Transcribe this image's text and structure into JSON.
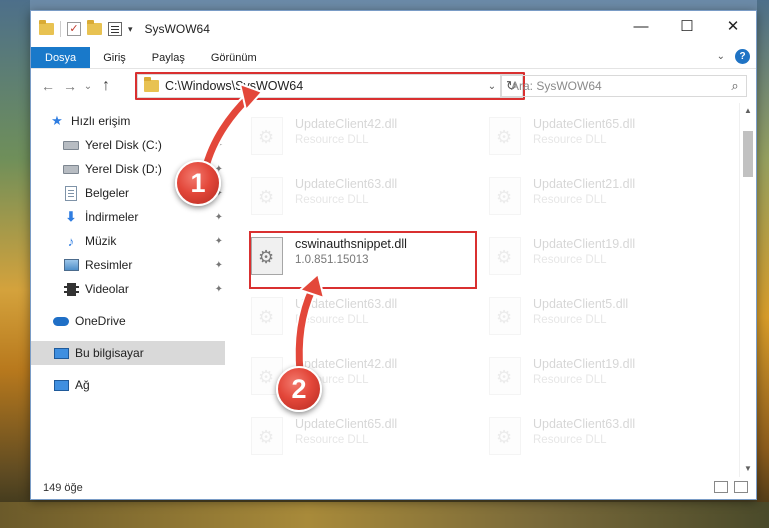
{
  "window": {
    "title": "SysWOW64",
    "controls": {
      "minimize": "—",
      "maximize": "☐",
      "close": "✕"
    }
  },
  "ribbon": {
    "tabs": [
      "Dosya",
      "Giriş",
      "Paylaş",
      "Görünüm"
    ],
    "expand_glyph": "⌄",
    "help_glyph": "?"
  },
  "nav": {
    "back": "←",
    "forward": "→",
    "recent": "⌄",
    "up": "↑",
    "address": "C:\\Windows\\SysWOW64",
    "address_dropdown": "⌄",
    "refresh": "↻",
    "search_placeholder": "Ara: SysWOW64",
    "search_glyph": "⌕"
  },
  "sidebar": {
    "items": [
      {
        "label": "Hızlı erişim",
        "icon": "star-icon",
        "pinned": false
      },
      {
        "label": "Yerel Disk (C:)",
        "icon": "drive-icon",
        "pinned": true
      },
      {
        "label": "Yerel Disk (D:)",
        "icon": "drive-icon",
        "pinned": true
      },
      {
        "label": "Belgeler",
        "icon": "documents-icon",
        "pinned": true
      },
      {
        "label": "İndirmeler",
        "icon": "downloads-icon",
        "pinned": true
      },
      {
        "label": "Müzik",
        "icon": "music-icon",
        "pinned": true
      },
      {
        "label": "Resimler",
        "icon": "pictures-icon",
        "pinned": true
      },
      {
        "label": "Videolar",
        "icon": "videos-icon",
        "pinned": true
      },
      {
        "label": "OneDrive",
        "icon": "onedrive-icon",
        "pinned": false
      },
      {
        "label": "Bu bilgisayar",
        "icon": "this-pc-icon",
        "pinned": false,
        "selected": true
      },
      {
        "label": "Ağ",
        "icon": "network-icon",
        "pinned": false
      }
    ],
    "pin_glyph": "📌"
  },
  "files": {
    "left_column": [
      {
        "name": "UpdateClient42.dll",
        "desc": "Resource DLL"
      },
      {
        "name": "UpdateClient63.dll",
        "desc": "Resource DLL"
      },
      {
        "name": "cswinauthsnippet.dll",
        "desc": "1.0.851.15013",
        "highlighted": true
      },
      {
        "name": "UpdateClient63.dll",
        "desc": "Resource DLL"
      },
      {
        "name": "UpdateClient42.dll",
        "desc": "Resource DLL"
      },
      {
        "name": "UpdateClient65.dll",
        "desc": "Resource DLL"
      }
    ],
    "right_column": [
      {
        "name": "UpdateClient65.dll",
        "desc": "Resource DLL"
      },
      {
        "name": "UpdateClient21.dll",
        "desc": "Resource DLL"
      },
      {
        "name": "UpdateClient19.dll",
        "desc": "Resource DLL"
      },
      {
        "name": "UpdateClient5.dll",
        "desc": "Resource DLL"
      },
      {
        "name": "UpdateClient19.dll",
        "desc": "Resource DLL"
      },
      {
        "name": "UpdateClient63.dll",
        "desc": "Resource DLL"
      }
    ]
  },
  "status": {
    "count": "149 öğe"
  },
  "callouts": {
    "one": "1",
    "two": "2"
  },
  "colors": {
    "accent": "#1979ca",
    "highlight": "#d93030",
    "callout": "#e3473a"
  }
}
